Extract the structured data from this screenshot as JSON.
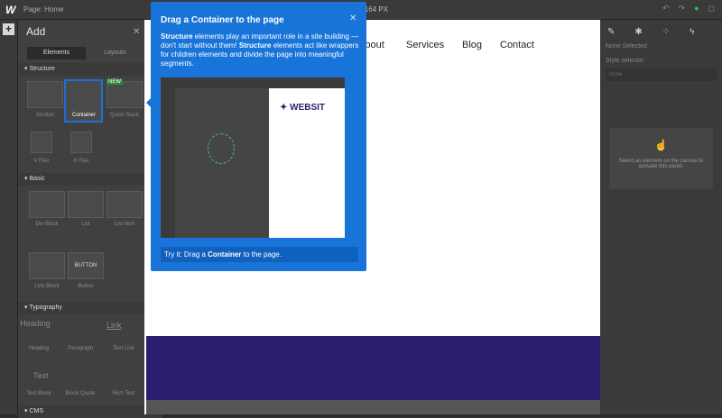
{
  "topbar": {
    "logo": "W",
    "page_label": "Page: Home",
    "size": "1164 PX"
  },
  "add_panel": {
    "title": "Add",
    "tabs": [
      "Elements",
      "Layouts"
    ],
    "sections": {
      "structure": "Structure",
      "basic": "Basic",
      "typography": "Typography",
      "cms": "CMS"
    },
    "structure_items": [
      "Section",
      "Container",
      "Quick Stack",
      "V Flex",
      "H Flex"
    ],
    "new_badge": "NEW",
    "basic_items": [
      "Div Block",
      "List",
      "List Item",
      "Link Block",
      "Button"
    ],
    "button_tile": "BUTTON",
    "typography_items": [
      "Heading",
      "Paragraph",
      "Text Link",
      "Text Block",
      "Block Quote",
      "Rich Text"
    ],
    "heading_tile": "Heading",
    "link_tile": "Link",
    "text_tile": "Text"
  },
  "canvas": {
    "nav": [
      "About",
      "Services",
      "Blog",
      "Contact"
    ],
    "nav_partial_letter": "A"
  },
  "tooltip": {
    "title": "Drag a Container to the page",
    "body_1": "Structure",
    "body_2": " elements play an important role in a site building — don't start without them! ",
    "body_3": "Structure",
    "body_4": " elements act like wrappers for children elements and divide the page into meaningful segments.",
    "try_prefix": "Try it: Drag a ",
    "try_bold": "Container",
    "try_suffix": " to the page.",
    "preview_website": "✦ WEBSIT"
  },
  "right_panel": {
    "none_selected": "None Selected",
    "style_selector": "Style selector",
    "none": "None",
    "empty_hint": "Select an element on the canvas to activate this panel."
  }
}
